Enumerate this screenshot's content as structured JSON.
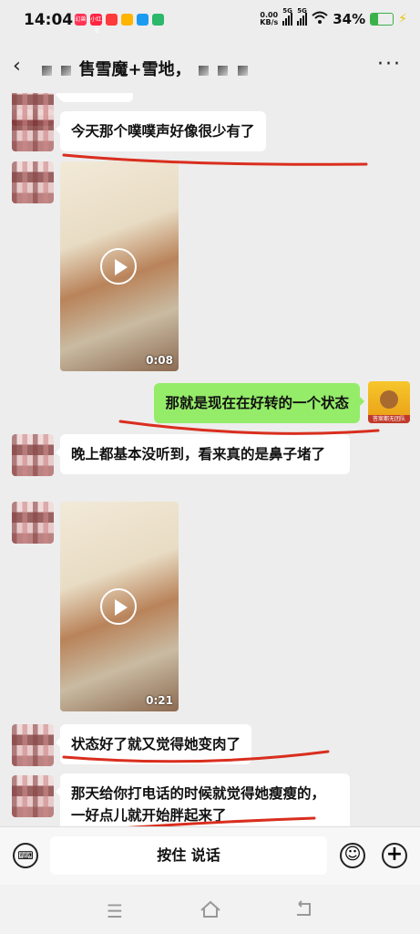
{
  "status": {
    "time": "14:04",
    "speed_value": "0.00",
    "speed_unit": "KB/s",
    "signal1": "5G",
    "signal2": "5G",
    "battery": "34%",
    "battery_level": 0.34,
    "battery_color": "#3bb14a",
    "apps": [
      {
        "label": "幻兽",
        "color": "#ff3355"
      },
      {
        "label": "小红书",
        "color": "#ff2442"
      },
      {
        "label": "",
        "color": "#ff3a3a"
      },
      {
        "label": "",
        "color": "#ffb400"
      },
      {
        "label": "",
        "color": "#1a9bf0"
      },
      {
        "label": "",
        "color": "#2bb86a"
      }
    ]
  },
  "header": {
    "back_icon": "chevron-left-icon",
    "title": "售雪魔+雪地，",
    "more_icon": "more-icon"
  },
  "messages": [
    {
      "side": "left",
      "type": "text",
      "text": "今天那个噗噗声好像很少有了"
    },
    {
      "side": "left",
      "type": "video",
      "duration": "0:08"
    },
    {
      "side": "right",
      "type": "text",
      "text": "那就是现在在好转的一个状态"
    },
    {
      "side": "left",
      "type": "text",
      "text": "晚上都基本没听到，看来真的是鼻子堵了"
    },
    {
      "side": "left",
      "type": "video",
      "duration": "0:21"
    },
    {
      "side": "left",
      "type": "text",
      "text": "状态好了就又觉得她变肉了"
    },
    {
      "side": "left",
      "type": "text",
      "text": "那天给你打电话的时候就觉得她瘦瘦的，一好点儿就开始胖起来了"
    }
  ],
  "my_avatar_caption": "答案都无团队",
  "input": {
    "hold_to_talk": "按住 说话",
    "keyboard_icon": "keyboard-icon",
    "emoji_icon": "emoji-icon",
    "plus_icon": "plus-icon"
  },
  "nav": {
    "menu_icon": "menu-icon",
    "home_icon": "home-icon",
    "back_icon": "back-icon"
  },
  "colors": {
    "bg": "#ededed",
    "my_bubble": "#95ec69",
    "annotation": "#d92e1e"
  }
}
